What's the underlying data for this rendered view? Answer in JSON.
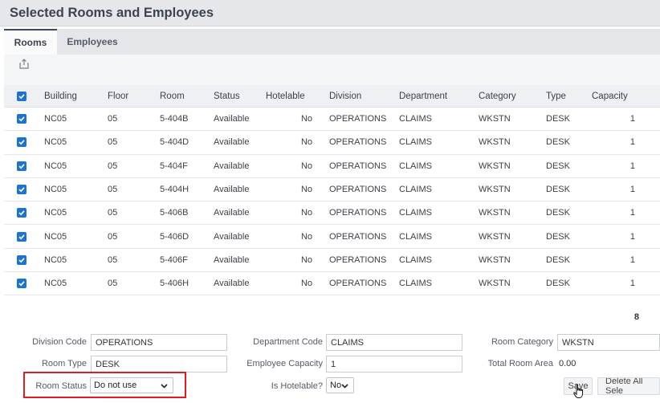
{
  "header": {
    "title": "Selected Rooms and Employees"
  },
  "tabs": [
    {
      "label": "Rooms"
    },
    {
      "label": "Employees"
    }
  ],
  "toolbar": {
    "export_icon": "export-icon"
  },
  "grid": {
    "columns": [
      "Building",
      "Floor",
      "Room",
      "Status",
      "Hotelable",
      "Division",
      "Department",
      "Category",
      "Type",
      "Capacity"
    ],
    "rows": [
      {
        "building": "NC05",
        "floor": "05",
        "room": "5-404B",
        "status": "Available",
        "hotelable": "No",
        "division": "OPERATIONS",
        "department": "CLAIMS",
        "category": "WKSTN",
        "type": "DESK",
        "capacity": "1"
      },
      {
        "building": "NC05",
        "floor": "05",
        "room": "5-404D",
        "status": "Available",
        "hotelable": "No",
        "division": "OPERATIONS",
        "department": "CLAIMS",
        "category": "WKSTN",
        "type": "DESK",
        "capacity": "1"
      },
      {
        "building": "NC05",
        "floor": "05",
        "room": "5-404F",
        "status": "Available",
        "hotelable": "No",
        "division": "OPERATIONS",
        "department": "CLAIMS",
        "category": "WKSTN",
        "type": "DESK",
        "capacity": "1"
      },
      {
        "building": "NC05",
        "floor": "05",
        "room": "5-404H",
        "status": "Available",
        "hotelable": "No",
        "division": "OPERATIONS",
        "department": "CLAIMS",
        "category": "WKSTN",
        "type": "DESK",
        "capacity": "1"
      },
      {
        "building": "NC05",
        "floor": "05",
        "room": "5-406B",
        "status": "Available",
        "hotelable": "No",
        "division": "OPERATIONS",
        "department": "CLAIMS",
        "category": "WKSTN",
        "type": "DESK",
        "capacity": "1"
      },
      {
        "building": "NC05",
        "floor": "05",
        "room": "5-406D",
        "status": "Available",
        "hotelable": "No",
        "division": "OPERATIONS",
        "department": "CLAIMS",
        "category": "WKSTN",
        "type": "DESK",
        "capacity": "1"
      },
      {
        "building": "NC05",
        "floor": "05",
        "room": "5-406F",
        "status": "Available",
        "hotelable": "No",
        "division": "OPERATIONS",
        "department": "CLAIMS",
        "category": "WKSTN",
        "type": "DESK",
        "capacity": "1"
      },
      {
        "building": "NC05",
        "floor": "05",
        "room": "5-406H",
        "status": "Available",
        "hotelable": "No",
        "division": "OPERATIONS",
        "department": "CLAIMS",
        "category": "WKSTN",
        "type": "DESK",
        "capacity": "1"
      }
    ],
    "total_capacity": "8"
  },
  "form": {
    "division_code_label": "Division Code",
    "division_code_value": "OPERATIONS",
    "department_code_label": "Department Code",
    "department_code_value": "CLAIMS",
    "room_category_label": "Room Category",
    "room_category_value": "WKSTN",
    "room_type_label": "Room Type",
    "room_type_value": "DESK",
    "employee_capacity_label": "Employee Capacity",
    "employee_capacity_value": "1",
    "total_room_area_label": "Total Room Area",
    "total_room_area_value": "0.00",
    "room_status_label": "Room Status",
    "room_status_value": "Do not use",
    "is_hotelable_label": "Is Hotelable?",
    "is_hotelable_value": "No"
  },
  "actions": {
    "save_label": "Save",
    "delete_all_label": "Delete All Sele"
  },
  "colors": {
    "accent": "#1b74d1",
    "highlight": "#e11b22",
    "tab_active_border": "#3b4a63"
  }
}
